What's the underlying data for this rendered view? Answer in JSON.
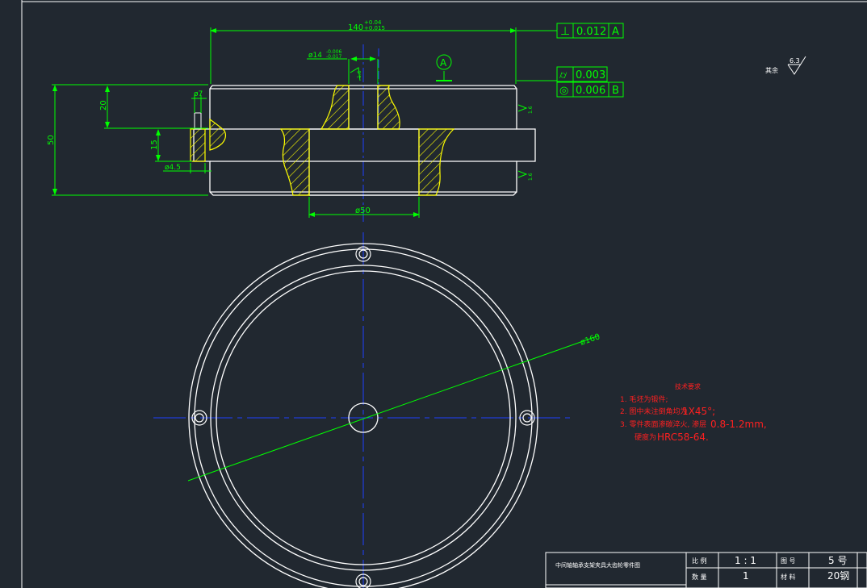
{
  "dims": {
    "overall_width": "140",
    "overall_width_tol_upper": "+0.04",
    "overall_width_tol_lower": "+0.015",
    "overall_height": "50",
    "upper_height": "20",
    "pin_height": "15",
    "pin_dia_small": "ø7",
    "pin_dia": "ø4.5",
    "center_hole": "ø14",
    "center_hole_tol_upper": "-0.006",
    "center_hole_tol_lower": "-0.017",
    "bore": "ø50",
    "outer_dia": "ø160",
    "surface_finish_side": "1.6",
    "roughness_global": "6.3",
    "roughness_global_label": "其余"
  },
  "gdt": {
    "perpendicularity": {
      "symbol": "⊥",
      "value": "0.012",
      "datum": "A"
    },
    "cylindricity": {
      "symbol": "⌭",
      "value": "0.003"
    },
    "runout": {
      "symbol": "◎",
      "value": "0.006",
      "datum": "B"
    },
    "datum_a": "A"
  },
  "tech_req": {
    "title": "技术要求",
    "line1": "1. 毛坯为锻件;",
    "line2_prefix": "2. 图中未注倒角均为",
    "line2_value": "1X45°;",
    "line3_prefix": "3. 零件表面渗碳淬火, 渗层",
    "line3_value": "0.8-1.2mm,",
    "line4_prefix": "硬度为",
    "line4_value": "HRC58-64."
  },
  "title_block": {
    "drawing_name": "中间轴轴承支架夹具大齿轮零件图",
    "scale_label": "比 例",
    "scale_value": "1 : 1",
    "drawing_no_label": "图 号",
    "drawing_no_value": "5 号",
    "qty_label": "数 量",
    "qty_value": "1",
    "material_label": "材 料",
    "material_value": "20钢"
  },
  "colors": {
    "background": "#212830",
    "outline": "#ffffff",
    "dimension": "#00ff00",
    "centerline": "#2040ff",
    "hatch": "#ffff00",
    "notes": "#ff2020"
  }
}
